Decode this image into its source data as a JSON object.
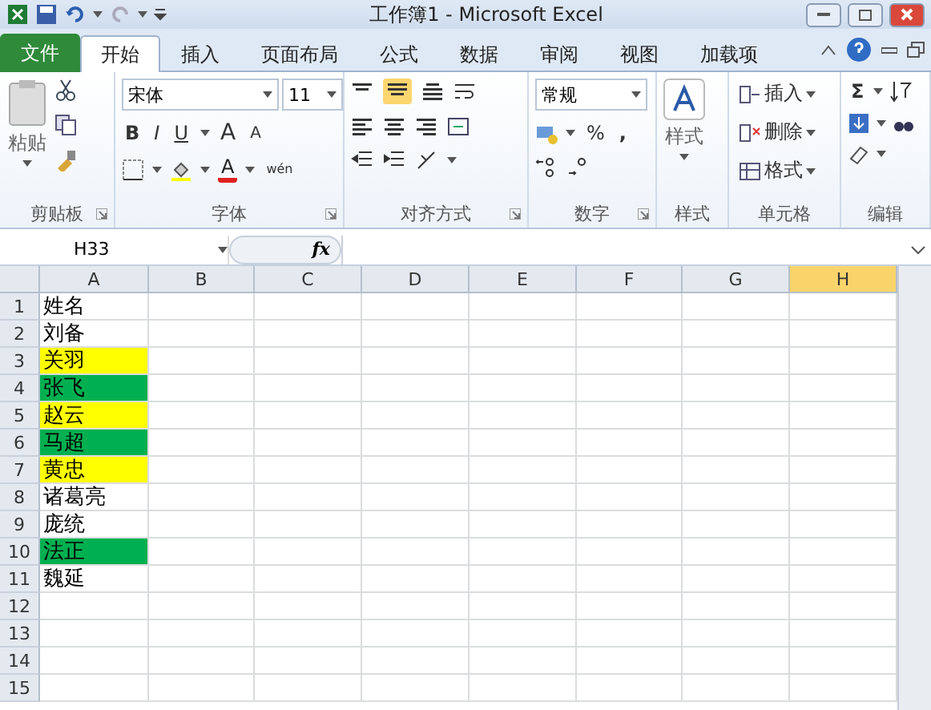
{
  "window": {
    "title": "工作簿1  -  Microsoft Excel"
  },
  "tabs": [
    {
      "label": "文件",
      "kind": "file",
      "selected": false
    },
    {
      "label": "开始",
      "kind": "tab",
      "selected": true
    },
    {
      "label": "插入",
      "kind": "tab",
      "selected": false
    },
    {
      "label": "页面布局",
      "kind": "tab",
      "selected": false
    },
    {
      "label": "公式",
      "kind": "tab",
      "selected": false
    },
    {
      "label": "数据",
      "kind": "tab",
      "selected": false
    },
    {
      "label": "审阅",
      "kind": "tab",
      "selected": false
    },
    {
      "label": "视图",
      "kind": "tab",
      "selected": false
    },
    {
      "label": "加载项",
      "kind": "tab",
      "selected": false
    }
  ],
  "ribbon": {
    "clipboard": {
      "label": "剪贴板",
      "paste": "粘贴"
    },
    "font": {
      "label": "字体",
      "font_name": "宋体",
      "font_size": "11",
      "bold": "B",
      "italic": "I",
      "underline": "U",
      "grow": "A",
      "shrink": "A",
      "font_color": "A",
      "phonetic": "wén"
    },
    "alignment": {
      "label": "对齐方式"
    },
    "number": {
      "label": "数字",
      "format": "常规",
      "percent": "%",
      "comma": ","
    },
    "styles": {
      "label": "样式",
      "button": "样式"
    },
    "cells": {
      "label": "单元格",
      "insert": "插入",
      "delete": "删除",
      "format": "格式"
    },
    "editing": {
      "label": "编辑",
      "sum": "Σ"
    }
  },
  "formula_bar": {
    "name_box": "H33",
    "fx": "fx"
  },
  "columns": [
    {
      "label": "A",
      "selected": false
    },
    {
      "label": "B",
      "selected": false
    },
    {
      "label": "C",
      "selected": false
    },
    {
      "label": "D",
      "selected": false
    },
    {
      "label": "E",
      "selected": false
    },
    {
      "label": "F",
      "selected": false
    },
    {
      "label": "G",
      "selected": false
    },
    {
      "label": "H",
      "selected": true
    }
  ],
  "rows": [
    {
      "number": "1",
      "a": "姓名"
    },
    {
      "number": "2",
      "a": "刘备"
    },
    {
      "number": "3",
      "a": "关羽",
      "color": "#ffff00"
    },
    {
      "number": "4",
      "a": "张飞",
      "color": "#00b050"
    },
    {
      "number": "5",
      "a": "赵云",
      "color": "#ffff00"
    },
    {
      "number": "6",
      "a": "马超",
      "color": "#00b050"
    },
    {
      "number": "7",
      "a": "黄忠",
      "color": "#ffff00"
    },
    {
      "number": "8",
      "a": "诸葛亮"
    },
    {
      "number": "9",
      "a": "庞统"
    },
    {
      "number": "10",
      "a": "法正",
      "color": "#00b050"
    },
    {
      "number": "11",
      "a": "魏延"
    },
    {
      "number": "12"
    },
    {
      "number": "13"
    },
    {
      "number": "14"
    },
    {
      "number": "15"
    }
  ]
}
